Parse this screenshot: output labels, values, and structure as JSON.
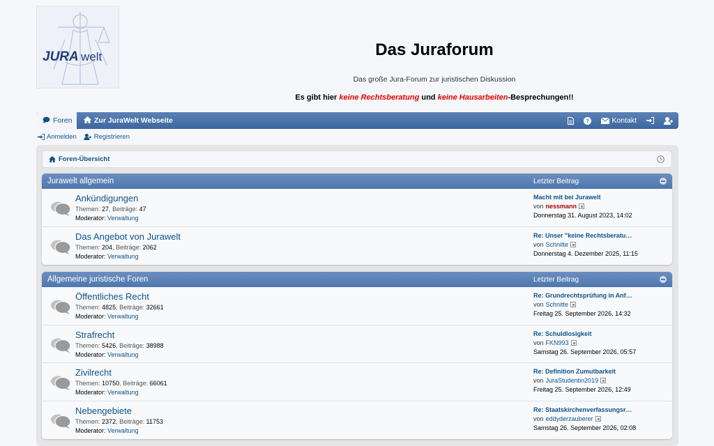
{
  "header": {
    "logo_text_1": "JURA",
    "logo_text_2": "welt",
    "title": "Das Juraforum",
    "description": "Das große Jura-Forum zur juristischen Diskussion",
    "notice_pre": "Es gibt hier ",
    "notice_red1": "keine Rechtsberatung",
    "notice_mid": " und ",
    "notice_red2": "keine Hausarbeiten",
    "notice_post": "-Besprechungen!!"
  },
  "nav": {
    "tab_foren": "Foren",
    "tab_home": "Zur JuraWelt Webseite",
    "kontakt": "Kontakt"
  },
  "sublinks": {
    "login": "Anmelden",
    "register": "Registrieren"
  },
  "breadcrumb": "Foren-Übersicht",
  "colors": {
    "nav": "#4a72a9",
    "link": "#105289",
    "notice_red": "#e60000"
  },
  "categories": [
    {
      "title": "Jurawelt allgemein",
      "last_label": "Letzter Beitrag",
      "forums": [
        {
          "name": "Ankündigungen",
          "themen_label": "Themen:",
          "themen": "27",
          "beitraege_label": "Beiträge:",
          "beitraege": "47",
          "mod_label": "Moderator:",
          "mod": "Verwaltung",
          "lp_title": "Macht mit bei Jurawelt",
          "lp_by": "von",
          "lp_user": "nessmann",
          "lp_date": "Donnerstag 31. August 2023, 14:02"
        },
        {
          "name": "Das Angebot von Jurawelt",
          "themen_label": "Themen:",
          "themen": "204",
          "beitraege_label": "Beiträge:",
          "beitraege": "2062",
          "mod_label": "Moderator:",
          "mod": "Verwaltung",
          "lp_title": "Re: Unser \"keine Rechtsberatu…",
          "lp_by": "von",
          "lp_user": "Schnitte",
          "lp_date": "Donnerstag 4. Dezember 2025, 11:15"
        }
      ]
    },
    {
      "title": "Allgemeine juristische Foren",
      "last_label": "Letzter Beitrag",
      "forums": [
        {
          "name": "Öffentliches Recht",
          "themen_label": "Themen:",
          "themen": "4825",
          "beitraege_label": "Beiträge:",
          "beitraege": "32661",
          "mod_label": "Moderator:",
          "mod": "Verwaltung",
          "lp_title": "Re: Grundrechtsprüfung in Anf…",
          "lp_by": "von",
          "lp_user": "Schnitte",
          "lp_date": "Freitag 25. September 2026, 14:32"
        },
        {
          "name": "Strafrecht",
          "themen_label": "Themen:",
          "themen": "5426",
          "beitraege_label": "Beiträge:",
          "beitraege": "38988",
          "mod_label": "Moderator:",
          "mod": "Verwaltung",
          "lp_title": "Re: Schuldlosigkeit",
          "lp_by": "von",
          "lp_user": "FKN993",
          "lp_date": "Samstag 26. September 2026, 05:57"
        },
        {
          "name": "Zivilrecht",
          "themen_label": "Themen:",
          "themen": "10750",
          "beitraege_label": "Beiträge:",
          "beitraege": "66061",
          "mod_label": "Moderator:",
          "mod": "Verwaltung",
          "lp_title": "Re: Definition Zumutbarkeit",
          "lp_by": "von",
          "lp_user": "JuraStudentin2019",
          "lp_date": "Freitag 25. September 2026, 12:49"
        },
        {
          "name": "Nebengebiete",
          "themen_label": "Themen:",
          "themen": "2372",
          "beitraege_label": "Beiträge:",
          "beitraege": "11753",
          "mod_label": "Moderator:",
          "mod": "Verwaltung",
          "lp_title": "Re: Staatskirchenverfassungsr…",
          "lp_by": "von",
          "lp_user": "eddyderzauberer",
          "lp_date": "Samstag 26. September 2026, 02:08"
        }
      ]
    }
  ]
}
